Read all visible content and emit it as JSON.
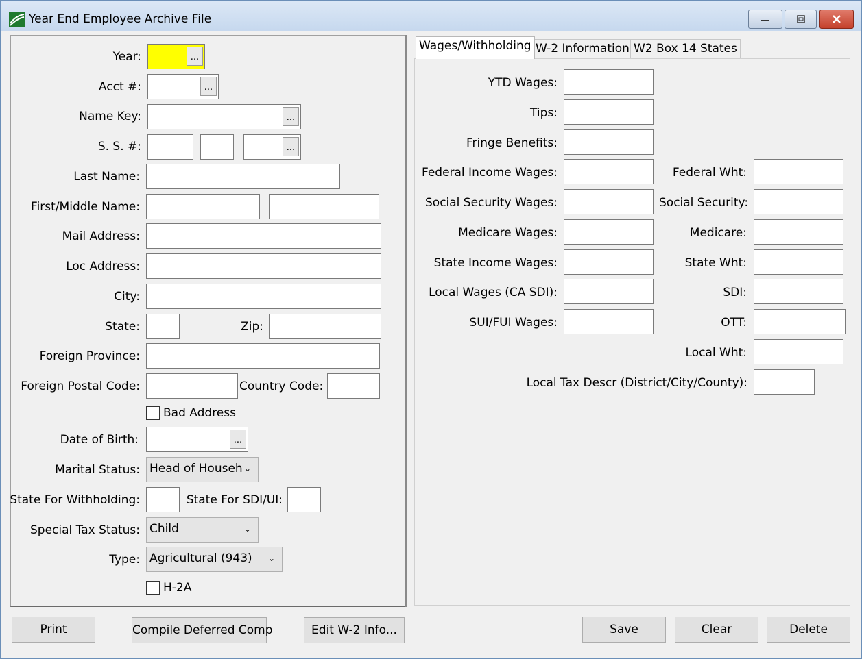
{
  "window": {
    "title": "Year End Employee Archive File",
    "controls": {
      "minimize": "minimize-icon",
      "restore": "restore-icon",
      "close": "close-icon"
    }
  },
  "form": {
    "year_label": "Year:",
    "acct_label": "Acct #:",
    "name_key_label": "Name Key:",
    "ss_label": "S. S. #:",
    "last_name_label": "Last Name:",
    "first_middle_label": "First/Middle Name:",
    "mail_address_label": "Mail Address:",
    "loc_address_label": "Loc Address:",
    "city_label": "City:",
    "state_label": "State:",
    "zip_label": "Zip:",
    "foreign_province_label": "Foreign Province:",
    "foreign_postal_label": "Foreign Postal Code:",
    "country_code_label": "Country Code:",
    "bad_address_label": "Bad Address",
    "dob_label": "Date of Birth:",
    "marital_label": "Marital Status:",
    "marital_value": "Head of Househ",
    "state_withholding_label": "State For Withholding:",
    "state_sdi_label": "State For SDI/UI:",
    "special_tax_label": "Special Tax Status:",
    "special_tax_value": "Child",
    "type_label": "Type:",
    "type_value": "Agricultural (943)",
    "h2a_label": "H-2A",
    "ellipsis": "..."
  },
  "tabs": [
    "Wages/Withholding",
    "W-2 Information",
    "W2 Box 14",
    "States"
  ],
  "wages": {
    "ytd_wages": "YTD Wages:",
    "tips": "Tips:",
    "fringe": "Fringe Benefits:",
    "fed_income_wages": "Federal Income Wages:",
    "ss_wages": "Social Security Wages:",
    "medicare_wages": "Medicare Wages:",
    "state_income_wages": "State Income Wages:",
    "local_wages": "Local Wages (CA SDI):",
    "sui_fui_wages": "SUI/FUI Wages:",
    "federal_wht": "Federal Wht:",
    "social_security": "Social Security:",
    "medicare": "Medicare:",
    "state_wht": "State Wht:",
    "sdi": "SDI:",
    "ott": "OTT:",
    "local_wht": "Local Wht:",
    "local_tax_descr": "Local Tax Descr (District/City/County):"
  },
  "buttons": {
    "print": "Print",
    "compile": "Compile Deferred Comp",
    "edit_w2": "Edit W-2 Info...",
    "save": "Save",
    "clear": "Clear",
    "delete": "Delete"
  },
  "colors": {
    "year_field": "#ffff00",
    "title_bar": "#c6d8ee",
    "close_button": "#c4412c"
  }
}
